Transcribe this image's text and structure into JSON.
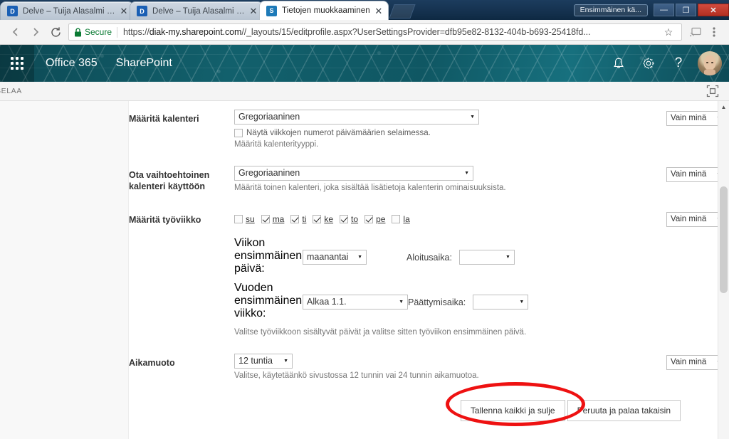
{
  "browser": {
    "tabs": [
      {
        "title": "Delve – Tuija Alasalmi – e",
        "favicon": "delve-icon",
        "active": false
      },
      {
        "title": "Delve – Tuija Alasalmi – e",
        "favicon": "delve-icon",
        "active": false
      },
      {
        "title": "Tietojen muokkaaminen",
        "favicon": "sharepoint-icon",
        "active": true
      }
    ],
    "new_tab_label": "+",
    "close_glyph": "✕",
    "taskbar_item": "Ensimmäinen kä...",
    "window_controls": {
      "minimize": "—",
      "maximize": "❐",
      "close": "✕"
    },
    "nav": {
      "back": "←",
      "forward": "→",
      "reload": "⟳"
    },
    "omnibox": {
      "security_label": "Secure",
      "url_prefix": "https://",
      "url_domain": "diak-my.sharepoint.com",
      "url_path": "//_layouts/15/editprofile.aspx?UserSettingsProvider=dfb95e82-8132-404b-b693-25418fd...",
      "star": "☆"
    }
  },
  "suite": {
    "waffle": "app-launcher-icon",
    "brand": "Office 365",
    "app": "SharePoint",
    "icons": {
      "notifications": "bell-icon",
      "settings": "gear-icon",
      "help": "?"
    },
    "avatar_alt": "user-avatar"
  },
  "ribbon": {
    "tab_label": "SELAA",
    "focus_icon": "focus-on-content-icon"
  },
  "form": {
    "rows": [
      {
        "label": "Määritä kalenteri",
        "select_value": "Gregoriaaninen",
        "checkbox": {
          "label": "Näytä viikkojen numerot päivämäärien selaimessa.",
          "checked": false
        },
        "hint": "Määritä kalenterityyppi.",
        "privacy": "Vain minä"
      },
      {
        "label": "Ota vaihtoehtoinen kalenteri käyttöön",
        "select_value": "Gregoriaaninen",
        "hint": "Määritä toinen kalenteri, joka sisältää lisätietoja kalenterin ominaisuuksista.",
        "privacy": "Vain minä"
      },
      {
        "label": "Määritä työviikko",
        "privacy": "Vain minä",
        "weekdays": [
          {
            "label": "su",
            "checked": false
          },
          {
            "label": "ma",
            "checked": true
          },
          {
            "label": "ti",
            "checked": true
          },
          {
            "label": "ke",
            "checked": true
          },
          {
            "label": "to",
            "checked": true
          },
          {
            "label": "pe",
            "checked": true
          },
          {
            "label": "la",
            "checked": false
          }
        ],
        "first_day_label": "Viikon ensimmäinen päivä:",
        "first_day_value": "maanantai",
        "start_time_label": "Aloitusaika:",
        "start_time_value": "",
        "first_week_label": "Vuoden ensimmäinen viikko:",
        "first_week_value": "Alkaa 1.1.",
        "end_time_label": "Päättymisaika:",
        "end_time_value": "",
        "hint": "Valitse työviikkoon sisältyvät päivät ja valitse sitten työviikon ensimmäinen päivä."
      },
      {
        "label": "Aikamuoto",
        "select_value": "12 tuntia",
        "hint": "Valitse, käytetäänkö sivustossa 12 tunnin vai 24 tunnin aikamuotoa.",
        "privacy": "Vain minä"
      }
    ],
    "buttons": {
      "save": "Tallenna kaikki ja sulje",
      "cancel": "Peruuta ja palaa takaisin"
    }
  },
  "annotation": {
    "shape": "red-ellipse",
    "color": "#ee1111",
    "targets": "Tallenna kaikki ja sulje"
  }
}
